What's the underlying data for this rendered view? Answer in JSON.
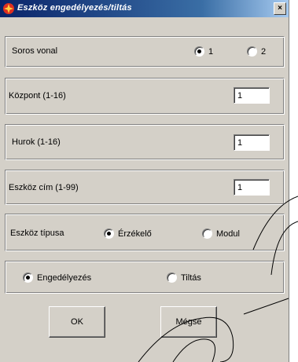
{
  "window": {
    "title": "Eszköz engedélyezés/tiltás",
    "close_glyph": "×"
  },
  "serial": {
    "label": "Soros vonal",
    "options": [
      "1",
      "2"
    ],
    "selected": "1"
  },
  "central": {
    "label": "Központ (1-16)",
    "value": "1"
  },
  "loop": {
    "label": "Hurok (1-16)",
    "value": "1"
  },
  "address": {
    "label": "Eszköz cím (1-99)",
    "value": "1"
  },
  "device_type": {
    "label": "Eszköz típusa",
    "options": [
      "Érzékelő",
      "Modul"
    ],
    "selected": "Érzékelő"
  },
  "mode": {
    "options": [
      "Engedélyezés",
      "Tiltás"
    ],
    "selected": "Engedélyezés"
  },
  "buttons": {
    "ok": "OK",
    "cancel": "Mégse"
  },
  "colors": {
    "dialog_bg": "#d4d0c8",
    "titlebar": "#0a246a",
    "icon": "#e03020"
  }
}
